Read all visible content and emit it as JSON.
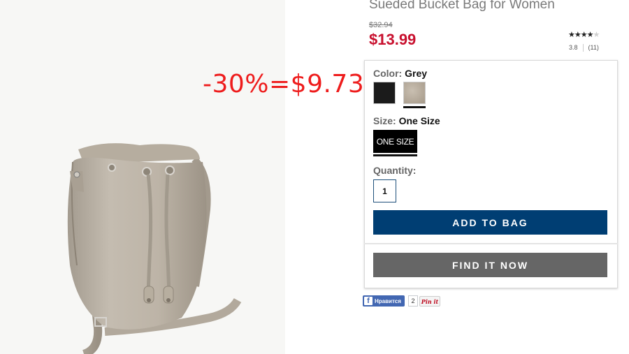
{
  "product": {
    "title": "Sueded Bucket Bag for Women",
    "old_price": "$32.94",
    "price": "$13.99",
    "stars_filled": "★★★★",
    "stars_empty": "★",
    "rating": "3.8",
    "review_count": "(11)"
  },
  "promo": {
    "text": "-30%=$9.73",
    "color": "#ee1c1c"
  },
  "color_selector": {
    "label": "Color:",
    "selected": "Grey",
    "swatches": [
      "black",
      "grey"
    ]
  },
  "size_selector": {
    "label": "Size:",
    "selected": "One Size",
    "option": "ONE SIZE"
  },
  "quantity": {
    "label": "Quantity:",
    "value": "1"
  },
  "buttons": {
    "add_to_bag": "ADD TO BAG",
    "find_it_now": "FIND IT NOW"
  },
  "social": {
    "fb_label": "Нравится",
    "fb_count": "2",
    "pin_label": "Pin it"
  },
  "colors": {
    "price_red": "#c8102e",
    "add_button_blue": "#003e73",
    "find_button_grey": "#666666"
  }
}
